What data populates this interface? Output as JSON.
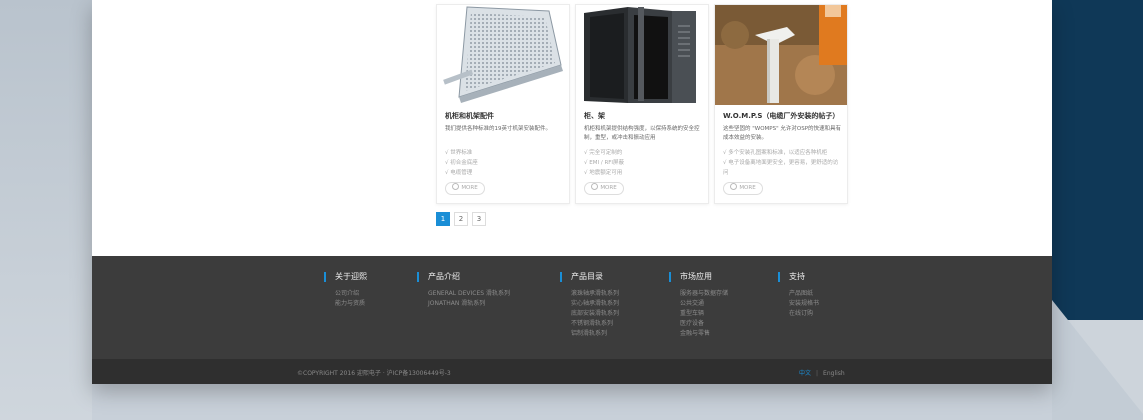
{
  "products": [
    {
      "title": "机柜和机架配件",
      "desc": "我们提供各种标准的19英寸机架安装配件。",
      "features": [
        "√ 世界标准",
        "√ 初合金底座",
        "√ 电缆管理"
      ],
      "more": "MORE",
      "image": "perforated-shelf-image"
    },
    {
      "title": "柜、架",
      "desc": "机柜和机架提供结构强度，以保持系统的安全控制，重型，或冲击和振动应用",
      "features": [
        "√ 完全可定制的",
        "√ EMI / RFI屏蔽",
        "√ 地震额定可用"
      ],
      "more": "MORE",
      "image": "cabinet-rack-image"
    },
    {
      "title": "W.O.M.P.S（电缆厂外安装的帖子）",
      "desc": "这些坚固的 \"WOMPS\" 允许对OSP的快速和具有成本效益的安装。",
      "features": [
        "√ 多个安装孔图案和标准，以适应各种机柜",
        "√ 电子设备离地面更安全，更容易，更舒适的访问"
      ],
      "more": "MORE",
      "image": "womps-post-image"
    }
  ],
  "pagination": {
    "pages": [
      "1",
      "2",
      "3"
    ],
    "active": "1"
  },
  "footer": {
    "columns": [
      {
        "heading": "关于迎熙",
        "links": [
          "公司介绍",
          "能力与资质"
        ]
      },
      {
        "heading": "产品介绍",
        "links": [
          "GENERAL DEVICES 滑轨系列",
          "JONATHAN 滑轨系列"
        ]
      },
      {
        "heading": "产品目录",
        "links": [
          "滚珠轴承滑轨系列",
          "实心轴承滑轨系列",
          "底部安装滑轨系列",
          "不锈钢滑轨系列",
          "铝制滑轨系列"
        ]
      },
      {
        "heading": "市场应用",
        "links": [
          "服务器与数据存储",
          "公共交通",
          "重型车辆",
          "医疗设备",
          "金融与零售"
        ]
      },
      {
        "heading": "支持",
        "links": [
          "产品图纸",
          "安装规格书",
          "在线订购"
        ]
      }
    ],
    "copyright": "©COPYRIGHT 2016  迎熙电子 · 沪ICP备13006449号-3",
    "lang_cn": "中文",
    "lang_sep": "|",
    "lang_en": "English"
  },
  "colors": {
    "accent": "#1a8ed6",
    "footer_bg": "#3c3c3c",
    "copybar_bg": "#2f2f2f",
    "navy": "#0f3857"
  }
}
